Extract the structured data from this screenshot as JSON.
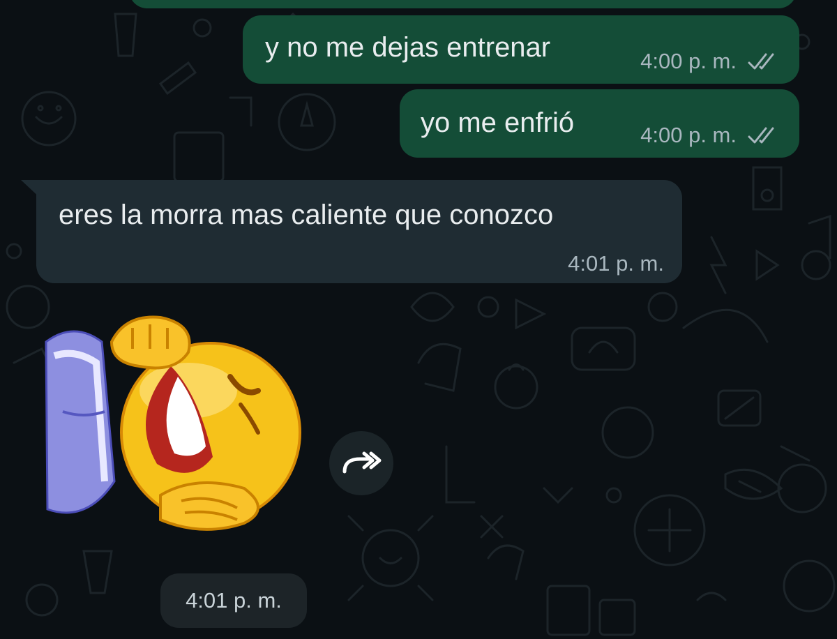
{
  "messages": [
    {
      "direction": "outgoing",
      "text": "y no me dejas entrenar",
      "time": "4:00 p. m.",
      "status_icon": "double-check-read-icon"
    },
    {
      "direction": "outgoing",
      "text": "yo me enfrió",
      "time": "4:00 p. m.",
      "status_icon": "double-check-read-icon"
    },
    {
      "direction": "incoming",
      "text": "eres la morra mas caliente que conozco",
      "time": "4:01 p. m."
    },
    {
      "direction": "incoming",
      "type": "sticker",
      "sticker": "laughing-emoji-sticker",
      "time": "4:01 p. m."
    }
  ],
  "actions": {
    "forward_icon": "forward-icon"
  },
  "colors": {
    "outgoing_bubble": "#144d37",
    "incoming_bubble": "#1f2c33",
    "background": "#0b1014",
    "meta_text": "#a9b7bf"
  }
}
